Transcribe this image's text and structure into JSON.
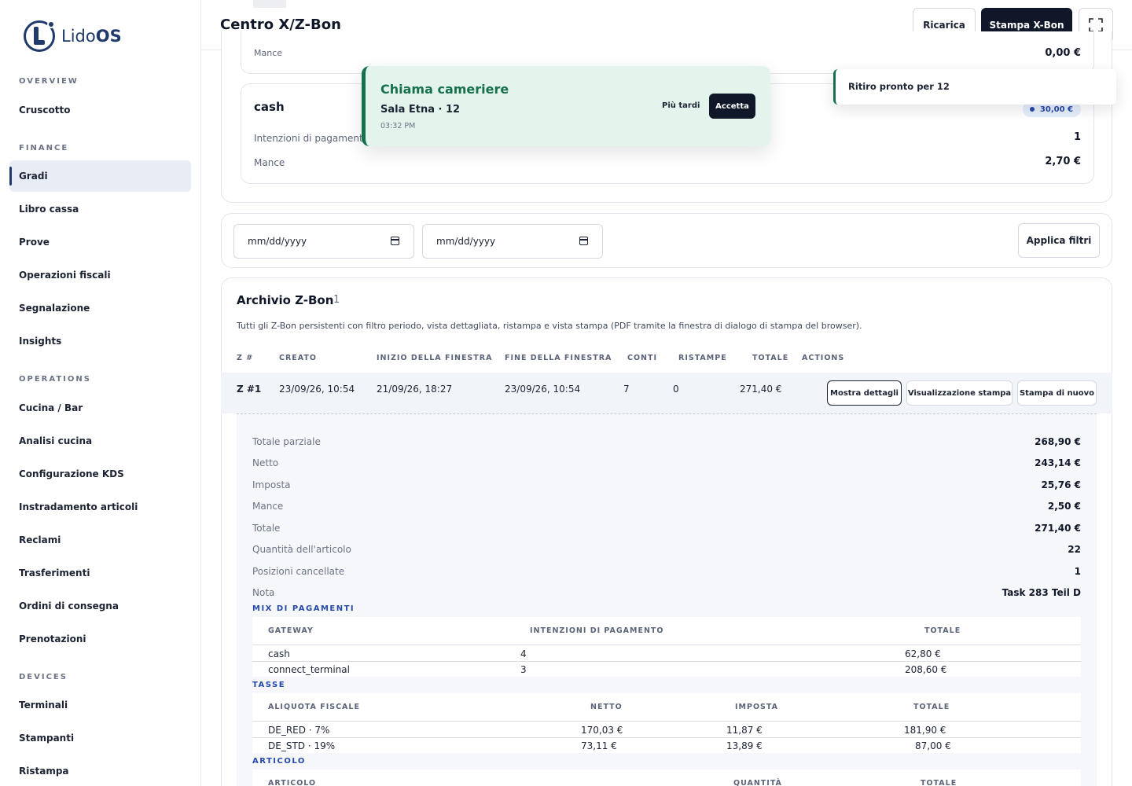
{
  "brand": {
    "name_prefix": "Lido",
    "name_suffix": "OS"
  },
  "sidebar": {
    "sections": [
      {
        "label": "OVERVIEW"
      },
      {
        "label": "FINANCE"
      },
      {
        "label": "OPERATIONS"
      },
      {
        "label": "DEVICES"
      }
    ],
    "items": [
      {
        "label": "Cruscotto"
      },
      {
        "label": "Gradi"
      },
      {
        "label": "Libro cassa"
      },
      {
        "label": "Prove"
      },
      {
        "label": "Operazioni fiscali"
      },
      {
        "label": "Segnalazione"
      },
      {
        "label": "Insights"
      },
      {
        "label": "Cucina / Bar"
      },
      {
        "label": "Analisi cucina"
      },
      {
        "label": "Configurazione KDS"
      },
      {
        "label": "Instradamento articoli"
      },
      {
        "label": "Reclami"
      },
      {
        "label": "Trasferimenti"
      },
      {
        "label": "Ordini di consegna"
      },
      {
        "label": "Prenotazioni"
      },
      {
        "label": "Terminali"
      },
      {
        "label": "Stampanti"
      },
      {
        "label": "Ristampa"
      }
    ]
  },
  "header": {
    "title": "Centro X/Z-Bon",
    "reload_label": "Ricarica",
    "print_xbon_label": "Stampa X-Bon",
    "fullscreen_icon": "fullscreen-icon"
  },
  "gateway_cards": {
    "top_partial": {
      "tip_label": "Mance",
      "tip_value": "0,00 €"
    },
    "cash": {
      "name": "cash",
      "badge": "30,00 €",
      "intents_label": "Intenzioni di pagamento",
      "intents_value": "1",
      "tip_label": "Mance",
      "tip_value": "2,70 €"
    }
  },
  "filters": {
    "from_placeholder": "mm/dd/yyyy",
    "to_placeholder": "mm/dd/yyyy",
    "apply_label": "Applica filtri"
  },
  "archive": {
    "title": "Archivio Z-Bon",
    "count": "1",
    "description": "Tutti gli Z-Bon persistenti con filtro periodo, vista dettagliata, ristampa e vista stampa (PDF tramite la finestra di dialogo di stampa del browser).",
    "columns": [
      "Z #",
      "CREATO",
      "INIZIO DELLA FINESTRA",
      "FINE DELLA FINESTRA",
      "CONTI",
      "RISTAMPE",
      "TOTALE",
      "ACTIONS"
    ],
    "rows": [
      {
        "z": "Z #1",
        "created": "23/09/26, 10:54",
        "window_start": "21/09/26, 18:27",
        "window_end": "23/09/26, 10:54",
        "accounts": "7",
        "reprints": "0",
        "total": "271,40 €",
        "actions": [
          "Mostra dettagli",
          "Visualizzazione stampa",
          "Stampa di nuovo"
        ]
      }
    ],
    "details": {
      "summary": [
        {
          "label": "Totale parziale",
          "value": "268,90 €"
        },
        {
          "label": "Netto",
          "value": "243,14 €"
        },
        {
          "label": "Imposta",
          "value": "25,76 €"
        },
        {
          "label": "Mance",
          "value": "2,50 €"
        },
        {
          "label": "Totale",
          "value": "271,40 €"
        },
        {
          "label": "Quantità dell'articolo",
          "value": "22"
        },
        {
          "label": "Posizioni cancellate",
          "value": "1"
        },
        {
          "label": "Nota",
          "value": "Task 283 Teil D"
        }
      ],
      "payment_mix": {
        "title": "MIX DI PAGAMENTI",
        "columns": [
          "GATEWAY",
          "INTENZIONI DI PAGAMENTO",
          "TOTALE"
        ],
        "rows": [
          [
            "cash",
            "4",
            "62,80 €"
          ],
          [
            "connect_terminal",
            "3",
            "208,60 €"
          ]
        ]
      },
      "taxes": {
        "title": "TASSE",
        "columns": [
          "ALIQUOTA FISCALE",
          "NETTO",
          "IMPOSTA",
          "TOTALE"
        ],
        "rows": [
          [
            "DE_RED · 7%",
            "170,03 €",
            "11,87 €",
            "181,90 €"
          ],
          [
            "DE_STD · 19%",
            "73,11 €",
            "13,89 €",
            "87,00 €"
          ]
        ]
      },
      "articles": {
        "title": "ARTICOLO",
        "columns": [
          "ARTICOLO",
          "QUANTITÀ",
          "TOTALE"
        ]
      }
    }
  },
  "toasts": {
    "waiter_call": {
      "title": "Chiama cameriere",
      "subtitle": "Sala Etna · 12",
      "time": "03:32 PM",
      "later_label": "Più tardi",
      "accept_label": "Accetta"
    },
    "ready": {
      "text": "Ritiro pronto per 12"
    }
  },
  "colors": {
    "accent": "#1f3a6b",
    "dark": "#0f1729",
    "success": "#16704b",
    "link": "#2549a8"
  }
}
